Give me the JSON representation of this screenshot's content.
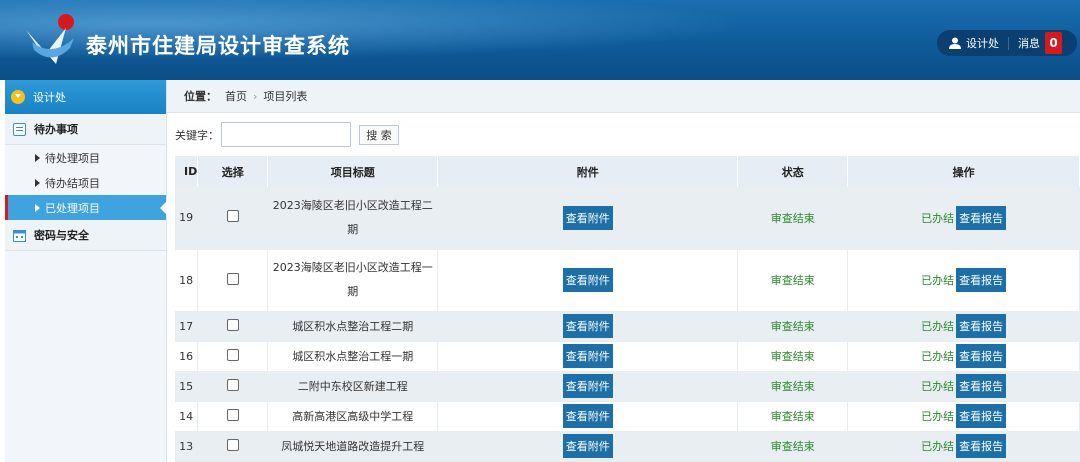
{
  "header": {
    "title": "泰州市住建局设计审查系统",
    "user": "设计处",
    "messages_label": "消息",
    "messages_count": "0"
  },
  "sidebar": {
    "section_title": "设计处",
    "groups": [
      {
        "label": "待办事项",
        "items": [
          "待处理项目",
          "待办结项目",
          "已处理项目"
        ]
      },
      {
        "label": "密码与安全",
        "items": []
      }
    ],
    "active_item": "已处理项目"
  },
  "breadcrumb": {
    "prefix": "位置：",
    "home": "首页",
    "current": "项目列表"
  },
  "search": {
    "label": "关键字：",
    "value": "",
    "button": "搜 索"
  },
  "table": {
    "headers": [
      "ID",
      "选择",
      "项目标题",
      "附件",
      "状态",
      "操作"
    ],
    "rows": [
      {
        "id": "19",
        "title_line1": "2023海陵区老旧小区改造工程二",
        "title_line2": "期",
        "attach": "查看附件",
        "status": "审查结束",
        "op_status": "已办结",
        "op_button": "查看报告"
      },
      {
        "id": "18",
        "title_line1": "2023海陵区老旧小区改造工程一",
        "title_line2": "期",
        "attach": "查看附件",
        "status": "审查结束",
        "op_status": "已办结",
        "op_button": "查看报告"
      },
      {
        "id": "17",
        "title_line1": "城区积水点整治工程二期",
        "title_line2": "",
        "attach": "查看附件",
        "status": "审查结束",
        "op_status": "已办结",
        "op_button": "查看报告"
      },
      {
        "id": "16",
        "title_line1": "城区积水点整治工程一期",
        "title_line2": "",
        "attach": "查看附件",
        "status": "审查结束",
        "op_status": "已办结",
        "op_button": "查看报告"
      },
      {
        "id": "15",
        "title_line1": "二附中东校区新建工程",
        "title_line2": "",
        "attach": "查看附件",
        "status": "审查结束",
        "op_status": "已办结",
        "op_button": "查看报告"
      },
      {
        "id": "14",
        "title_line1": "高新高港区高级中学工程",
        "title_line2": "",
        "attach": "查看附件",
        "status": "审查结束",
        "op_status": "已办结",
        "op_button": "查看报告"
      },
      {
        "id": "13",
        "title_line1": "凤城悦天地道路改造提升工程",
        "title_line2": "",
        "attach": "查看附件",
        "status": "审查结束",
        "op_status": "已办结",
        "op_button": "查看报告"
      }
    ]
  }
}
